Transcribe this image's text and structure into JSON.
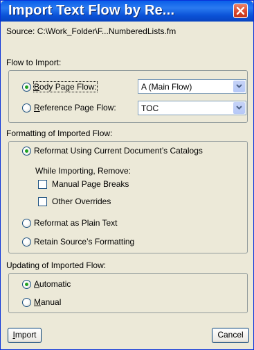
{
  "window": {
    "title": "Import Text Flow by Re...",
    "source_text": "Source:  C:\\Work_Folder\\F...NumberedLists.fm"
  },
  "flow_to_import": {
    "heading": "Flow to Import:",
    "body_page_flow_label": "Body Page Flow:",
    "body_page_flow_value": "A (Main Flow)",
    "reference_page_flow_label": "Reference Page Flow:",
    "reference_page_flow_value": "TOC"
  },
  "formatting": {
    "heading": "Formatting of Imported Flow:",
    "reformat_catalogs": "Reformat Using Current Document’s Catalogs",
    "while_importing": "While Importing, Remove:",
    "manual_page_breaks": "Manual Page Breaks",
    "other_overrides": "Other Overrides",
    "plain_text": "Reformat as Plain Text",
    "retain_source": "Retain Source’s Formatting"
  },
  "updating": {
    "heading": "Updating of Imported Flow:",
    "automatic": "Automatic",
    "manual": "Manual"
  },
  "buttons": {
    "import": "Import",
    "cancel": "Cancel"
  },
  "colors": {
    "title_bar": "#0A5FE9",
    "dialog_bg": "#ECE9D8",
    "radio_dot": "#21A121",
    "close_button": "#D9452A"
  }
}
